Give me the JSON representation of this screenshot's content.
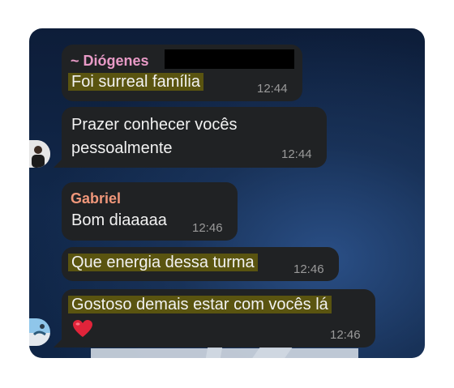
{
  "messages": [
    {
      "sender": "~ Diógenes",
      "text": "Foi surreal família",
      "time": "12:44"
    },
    {
      "text_line1": "Prazer conhecer vocês",
      "text_line2": "pessoalmente",
      "time": "12:44"
    },
    {
      "sender": "Gabriel",
      "text": "Bom diaaaaa",
      "time": "12:46"
    },
    {
      "text": "Que energia dessa turma",
      "time": "12:46"
    },
    {
      "text": "Gostoso demais estar com vocês lá",
      "emoji": "❤️",
      "time": "12:46"
    }
  ],
  "colors": {
    "sender_diogenes": "#e89ac6",
    "sender_gabriel": "#f0977a",
    "bubble": "#202224",
    "highlight": "#5a5410",
    "timestamp": "#9a9a9a"
  },
  "icons": [
    "avatar-male",
    "avatar-beach",
    "heart-emoji"
  ]
}
